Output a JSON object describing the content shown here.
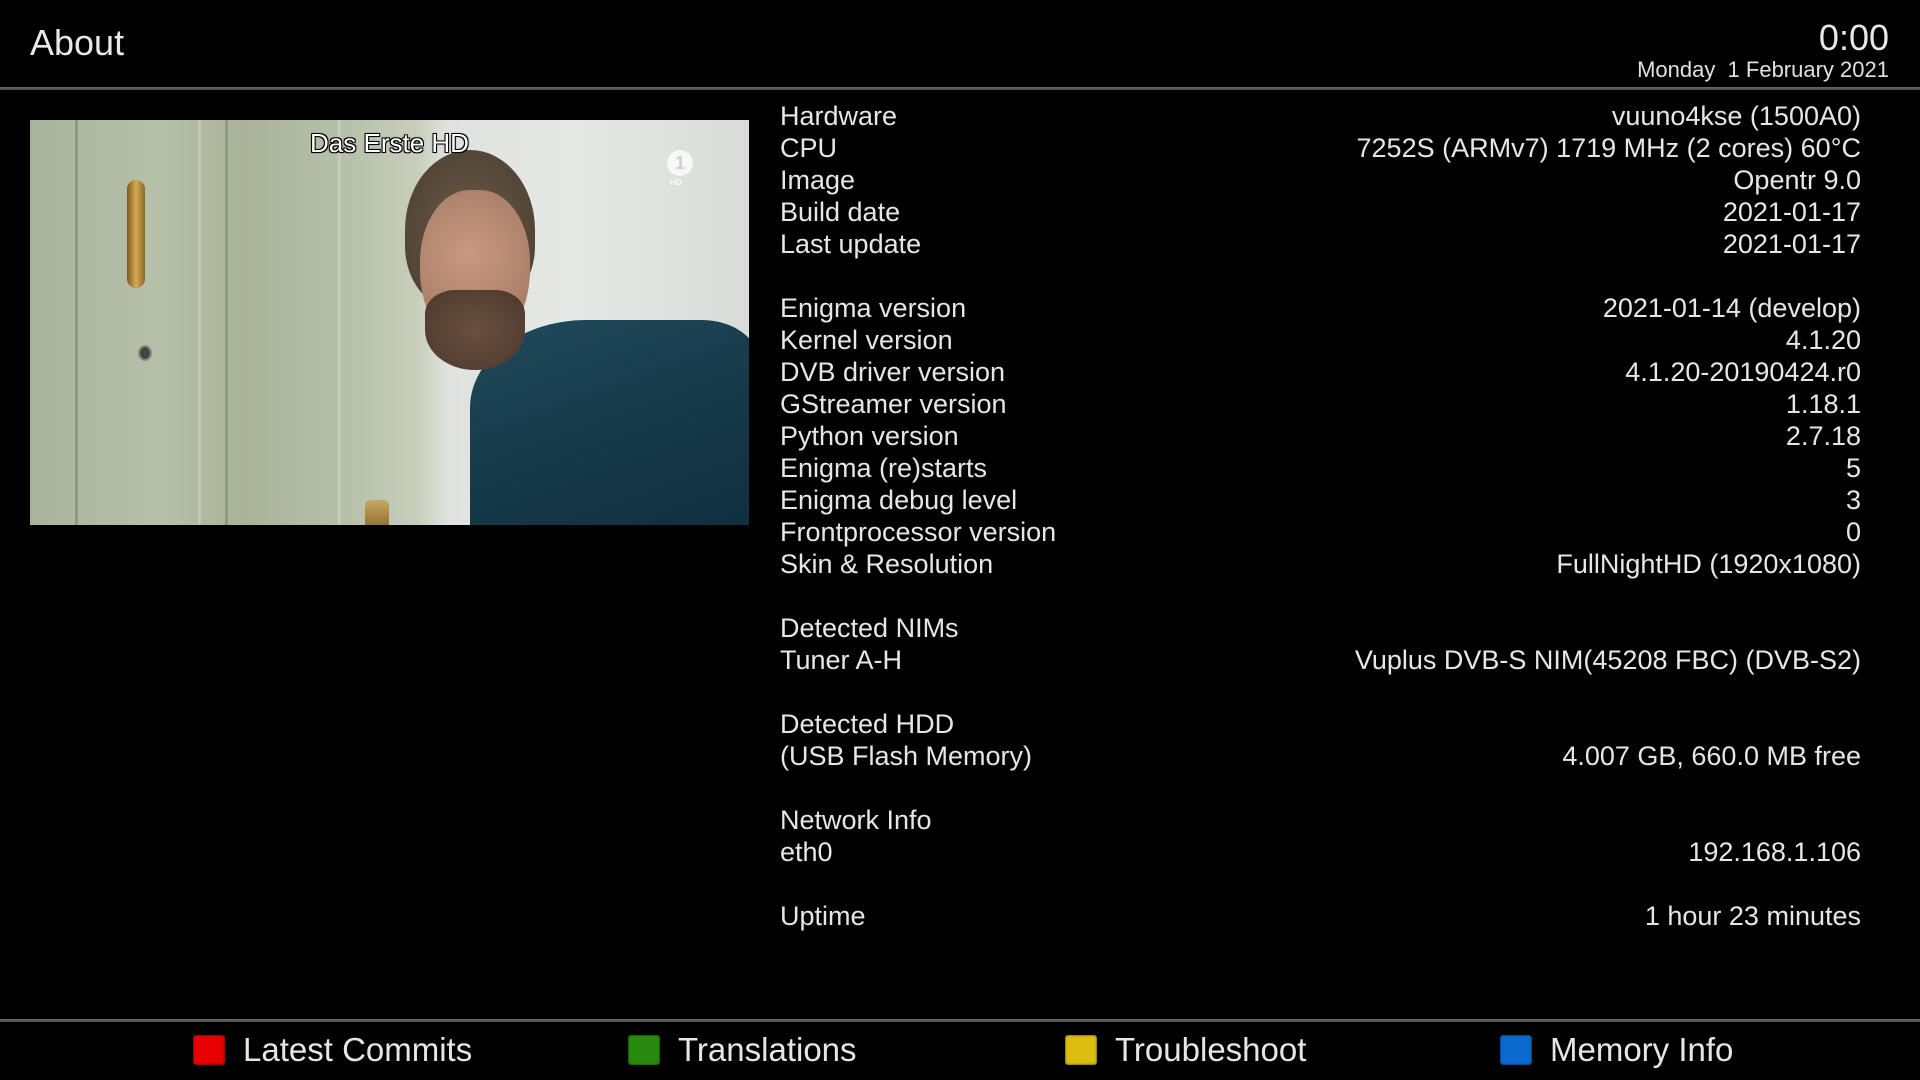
{
  "header": {
    "title": "About",
    "clock": "0:00",
    "date": "Monday  1 February 2021"
  },
  "video": {
    "channel_name": "Das Erste HD",
    "logo_glyph": "1",
    "logo_sub": "HD"
  },
  "info": {
    "sections": [
      [
        {
          "label": "Hardware",
          "value": "vuuno4kse (1500A0)"
        },
        {
          "label": "CPU",
          "value": "7252S (ARMv7) 1719 MHz (2 cores) 60°C"
        },
        {
          "label": "Image",
          "value": "Opentr 9.0"
        },
        {
          "label": "Build date",
          "value": "2021-01-17"
        },
        {
          "label": "Last update",
          "value": "2021-01-17"
        }
      ],
      [
        {
          "label": "Enigma version",
          "value": "2021-01-14 (develop)"
        },
        {
          "label": "Kernel version",
          "value": "4.1.20"
        },
        {
          "label": "DVB driver version",
          "value": "4.1.20-20190424.r0"
        },
        {
          "label": "GStreamer version",
          "value": "1.18.1"
        },
        {
          "label": "Python version",
          "value": "2.7.18"
        },
        {
          "label": "Enigma (re)starts",
          "value": "5"
        },
        {
          "label": "Enigma debug level",
          "value": "3"
        },
        {
          "label": "Frontprocessor version",
          "value": "0"
        },
        {
          "label": "Skin & Resolution",
          "value": "FullNightHD (1920x1080)"
        }
      ],
      [
        {
          "label": "Detected NIMs",
          "value": ""
        },
        {
          "label": "Tuner A-H",
          "value": "Vuplus DVB-S NIM(45208 FBC) (DVB-S2)"
        }
      ],
      [
        {
          "label": "Detected HDD",
          "value": ""
        },
        {
          "label": "(USB Flash Memory)",
          "value": "4.007 GB, 660.0 MB free"
        }
      ],
      [
        {
          "label": "Network Info",
          "value": ""
        },
        {
          "label": "eth0",
          "value": "192.168.1.106"
        }
      ],
      [
        {
          "label": "Uptime",
          "value": "1 hour 23 minutes"
        }
      ]
    ]
  },
  "footer": {
    "buttons": [
      {
        "key": "red",
        "color": "#e80000",
        "label": "Latest Commits"
      },
      {
        "key": "green",
        "color": "#2a8a10",
        "label": "Translations"
      },
      {
        "key": "yellow",
        "color": "#dcbc10",
        "label": "Troubleshoot"
      },
      {
        "key": "blue",
        "color": "#0a6ad0",
        "label": "Memory Info"
      }
    ]
  }
}
